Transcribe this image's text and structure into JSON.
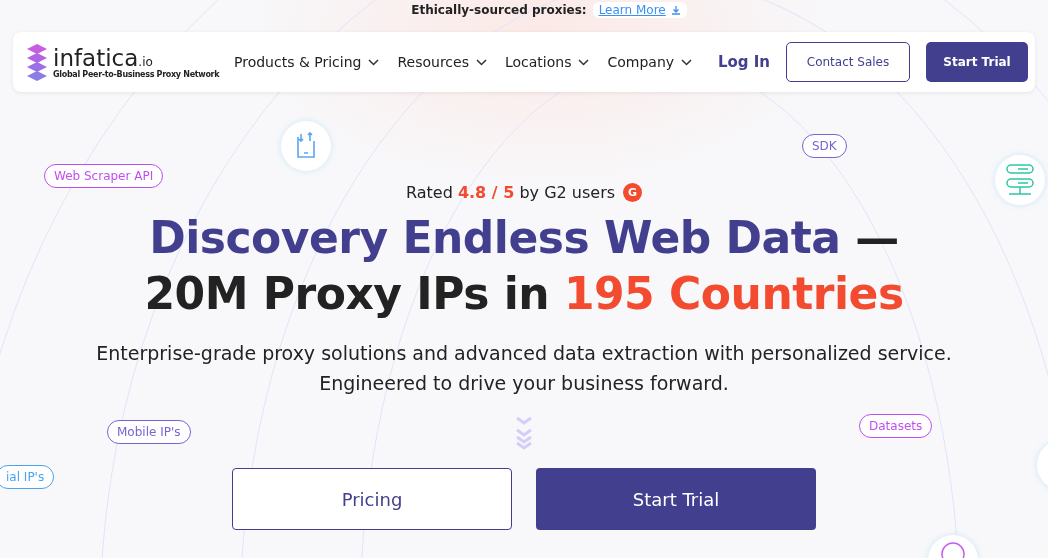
{
  "announcement": {
    "text": "Ethically-sourced proxies:",
    "link": "Learn More"
  },
  "logo": {
    "name": "infatica",
    "suffix": ".io",
    "tagline": "Global Peer-to-Business Proxy Network"
  },
  "nav": {
    "items": [
      "Products & Pricing",
      "Resources",
      "Locations",
      "Company"
    ],
    "login": "Log In",
    "contact": "Contact Sales",
    "trial": "Start Trial"
  },
  "rating": {
    "prefix": "Rated",
    "score": "4.8 / 5",
    "suffix": "by G2 users",
    "badge": "G"
  },
  "headline": [
    [
      {
        "text": "Discovery Endless Web Data",
        "kind": "brand"
      },
      {
        "text": " —",
        "kind": "plain"
      }
    ],
    [
      {
        "text": "20M Proxy IPs in ",
        "kind": "plain"
      },
      {
        "text": "195 Countries",
        "kind": "accent"
      }
    ]
  ],
  "subtitle": [
    "Enterprise-grade proxy solutions and advanced data extraction with personalized service.",
    "Engineered to drive your business forward."
  ],
  "tags": [
    {
      "label": "Web Scraper API",
      "color": "#c04ef0"
    },
    {
      "label": "SDK",
      "color": "#7a62d0"
    },
    {
      "label": "Mobile IP's",
      "color": "#7a62d0"
    },
    {
      "label": "ial IP's",
      "color": "#4aa3f0"
    },
    {
      "label": "Datasets",
      "color": "#c04ef0"
    }
  ],
  "buttons": {
    "secondary": "Pricing",
    "primary": "Start Trial"
  }
}
